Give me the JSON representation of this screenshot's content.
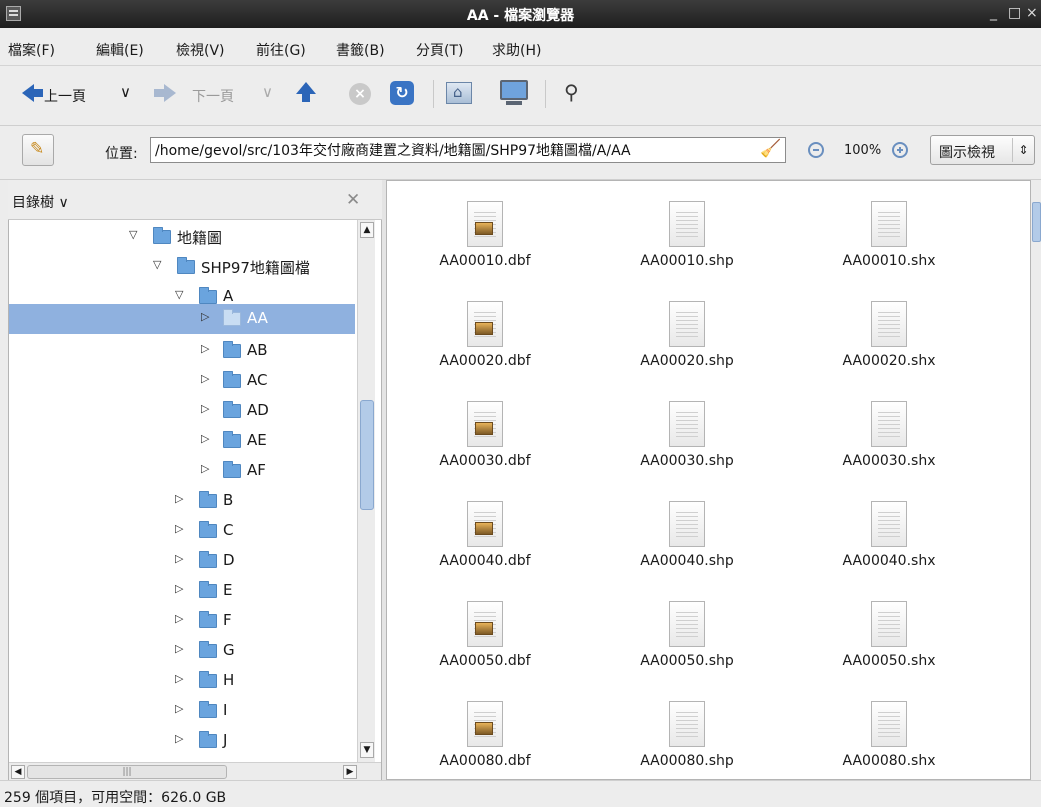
{
  "window": {
    "title": "AA - 檔案瀏覽器",
    "minimize": "_",
    "maximize": "□",
    "close": "×"
  },
  "menu": [
    "檔案(F)",
    "編輯(E)",
    "檢視(V)",
    "前往(G)",
    "書籤(B)",
    "分頁(T)",
    "求助(H)"
  ],
  "toolbar": {
    "back_label": "上一頁",
    "forward_label": "下一頁",
    "dropdown_glyph": "∨"
  },
  "location": {
    "label": "位置:",
    "path": "/home/gevol/src/103年交付廠商建置之資料/地籍圖/SHP97地籍圖檔/A/AA",
    "zoom": "100%",
    "view_mode": "圖示檢視"
  },
  "sidebar": {
    "title": "目錄樹",
    "tree": [
      {
        "label": "地籍圖",
        "expanded": true,
        "level": 0
      },
      {
        "label": "SHP97地籍圖檔",
        "expanded": true,
        "level": 1
      },
      {
        "label": "A",
        "expanded": true,
        "level": 2
      },
      {
        "label": "AA",
        "expanded": false,
        "level": 3,
        "selected": true
      },
      {
        "label": "AB",
        "expanded": false,
        "level": 3
      },
      {
        "label": "AC",
        "expanded": false,
        "level": 3
      },
      {
        "label": "AD",
        "expanded": false,
        "level": 3
      },
      {
        "label": "AE",
        "expanded": false,
        "level": 3
      },
      {
        "label": "AF",
        "expanded": false,
        "level": 3
      },
      {
        "label": "B",
        "expanded": false,
        "level": 2
      },
      {
        "label": "C",
        "expanded": false,
        "level": 2
      },
      {
        "label": "D",
        "expanded": false,
        "level": 2
      },
      {
        "label": "E",
        "expanded": false,
        "level": 2
      },
      {
        "label": "F",
        "expanded": false,
        "level": 2
      },
      {
        "label": "G",
        "expanded": false,
        "level": 2
      },
      {
        "label": "H",
        "expanded": false,
        "level": 2
      },
      {
        "label": "I",
        "expanded": false,
        "level": 2
      },
      {
        "label": "J",
        "expanded": false,
        "level": 2
      }
    ]
  },
  "files": [
    {
      "name": "AA00010.dbf",
      "type": "dbf-file-icon"
    },
    {
      "name": "AA00010.shp",
      "type": "text-file-icon"
    },
    {
      "name": "AA00010.shx",
      "type": "text-file-icon"
    },
    {
      "name": "AA00020.dbf",
      "type": "dbf-file-icon"
    },
    {
      "name": "AA00020.shp",
      "type": "text-file-icon"
    },
    {
      "name": "AA00020.shx",
      "type": "text-file-icon"
    },
    {
      "name": "AA00030.dbf",
      "type": "dbf-file-icon"
    },
    {
      "name": "AA00030.shp",
      "type": "text-file-icon"
    },
    {
      "name": "AA00030.shx",
      "type": "text-file-icon"
    },
    {
      "name": "AA00040.dbf",
      "type": "dbf-file-icon"
    },
    {
      "name": "AA00040.shp",
      "type": "text-file-icon"
    },
    {
      "name": "AA00040.shx",
      "type": "text-file-icon"
    },
    {
      "name": "AA00050.dbf",
      "type": "dbf-file-icon"
    },
    {
      "name": "AA00050.shp",
      "type": "text-file-icon"
    },
    {
      "name": "AA00050.shx",
      "type": "text-file-icon"
    },
    {
      "name": "AA00080.dbf",
      "type": "dbf-file-icon"
    },
    {
      "name": "AA00080.shp",
      "type": "text-file-icon"
    },
    {
      "name": "AA00080.shx",
      "type": "text-file-icon"
    }
  ],
  "status": {
    "text": "259 個項目，可用空間：626.0 GB"
  }
}
